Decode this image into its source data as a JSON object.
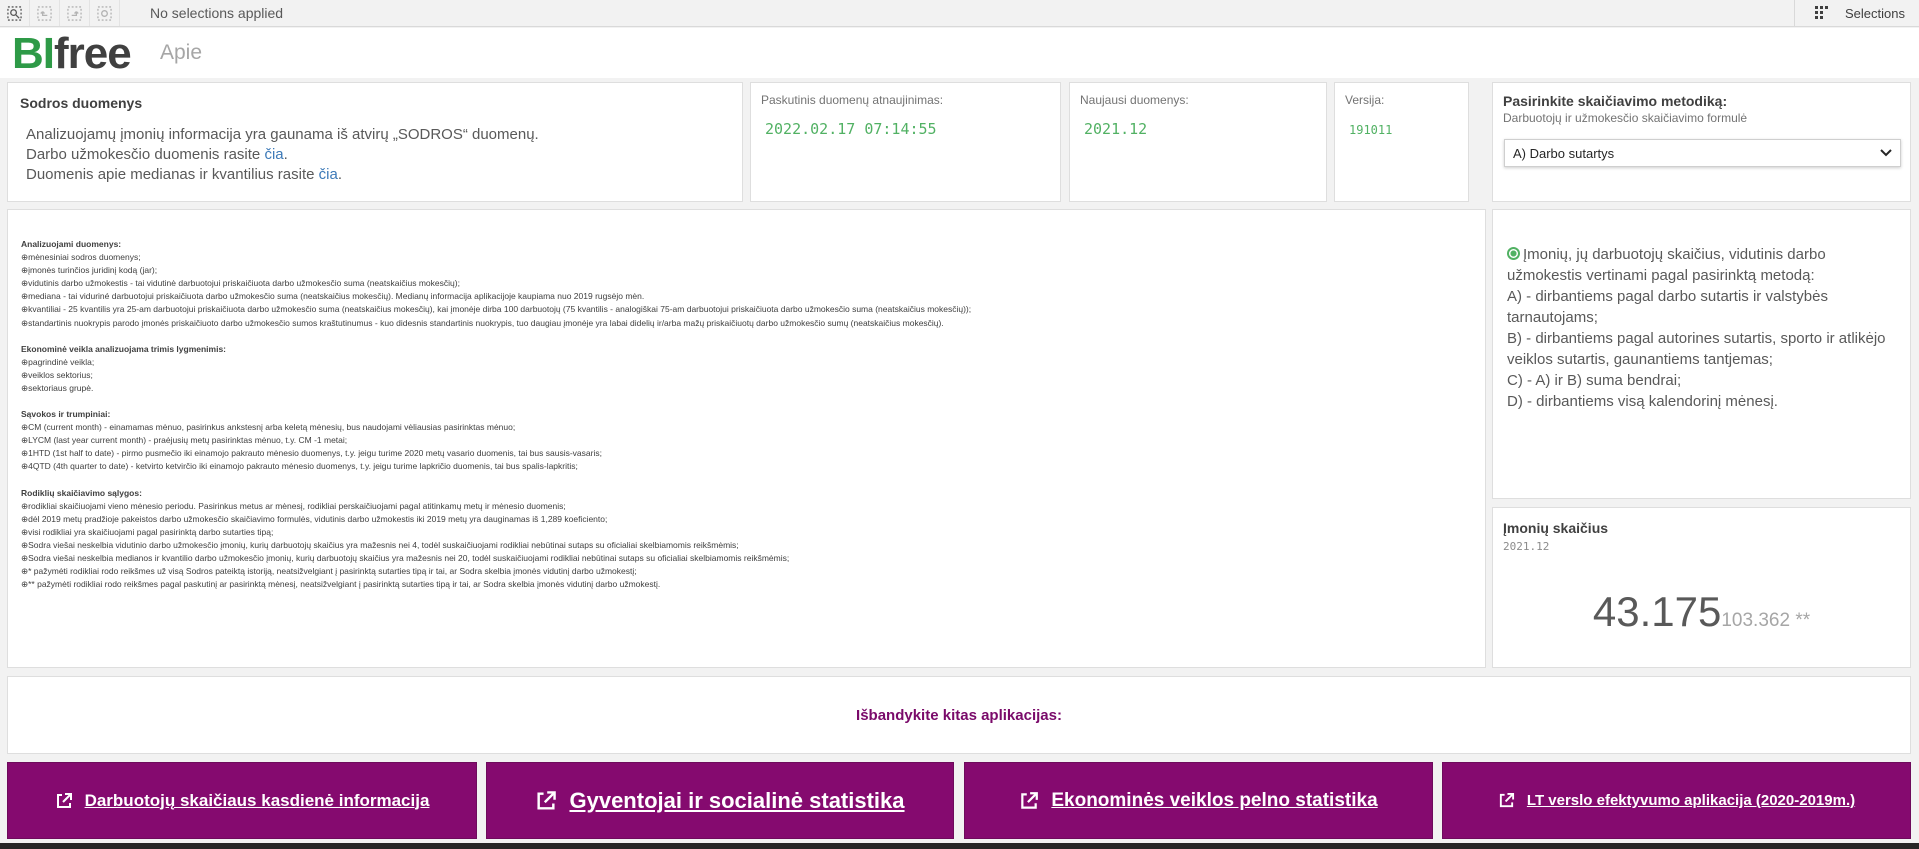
{
  "toolbar": {
    "no_selections": "No selections applied",
    "selections_label": "Selections"
  },
  "header": {
    "logo_bi": "BI",
    "logo_free": "free",
    "sheet_title": "Apie"
  },
  "sodros": {
    "title": "Sodros duomenys",
    "line1": "Analizuojamų įmonių informacija yra gaunama iš atvirų „SODROS“ duomenų.",
    "line2_prefix": "Darbo užmokesčio duomenis rasite ",
    "line2_link": "čia",
    "line2_suffix": ".",
    "line3_prefix": "Duomenis apie medianas ir kvantilius rasite ",
    "line3_link": "čia",
    "line3_suffix": "."
  },
  "kpis": {
    "last_update_label": "Paskutinis duomenų atnaujinimas:",
    "last_update_value": "2022.02.17 07:14:55",
    "latest_data_label": "Naujausi duomenys:",
    "latest_data_value": "2021.12",
    "version_label": "Versija:",
    "version_value": "191011"
  },
  "method": {
    "title": "Pasirinkite skaičiavimo metodiką:",
    "subtitle": "Darbuotojų ir užmokesčio skaičiavimo formulė",
    "selected": "A) Darbo sutartys"
  },
  "info": {
    "sec1_title": "Analizuojami duomenys:",
    "sec1_items": [
      "⊕mėnesiniai sodros duomenys;",
      "⊕įmonės turinčios juridinį kodą (jar);",
      "⊕vidutinis darbo užmokestis - tai vidutinė darbuotojui priskaičiuota darbo užmokesčio suma (neatskaičius mokesčių);",
      "⊕mediana - tai viduriné darbuotojui priskaičiuota darbo užmokesčio suma (neatskaičius mokesčių). Medianų informacija aplikacijoje kaupiama nuo 2019 rugsėjo mėn.",
      "⊕kvantiliai - 25 kvantilis yra 25-am darbuotojui priskaičiuota darbo užmokesčio suma (neatskaičius mokesčių), kai įmonėje dirba 100 darbuotojų (75 kvantilis - analogiškai 75-am darbuotojui priskaičiuota darbo užmokesčio suma (neatskaičius mokesčių));",
      "⊕standartinis nuokrypis parodo įmonės priskaičiuoto darbo užmokesčio sumos kraštutinumus - kuo didesnis standartinis nuokrypis, tuo daugiau įmonėje yra labai didelių ir/arba mažų priskaičiuotų darbo užmokesčio sumų (neatskaičius mokesčių)."
    ],
    "sec2_title": "Ekonominė veikla analizuojama trimis lygmenimis:",
    "sec2_items": [
      "⊕pagrindinė veikla;",
      "⊕veiklos sektorius;",
      "⊕sektoriaus grupė."
    ],
    "sec3_title": "Sąvokos ir trumpiniai:",
    "sec3_items": [
      "⊕CM (current month) - einamamas mėnuo, pasirinkus ankstesnį arba keletą mėnesių, bus naudojami vėliausias pasirinktas mėnuo;",
      "⊕LYCM (last year current month) - praėjusių metų pasirinktas mėnuo, t.y. CM -1 metai;",
      "⊕1HTD (1st half to date) - pirmo pusmečio iki einamojo pakrauto mėnesio duomenys, t.y. jeigu turime 2020 metų vasario duomenis, tai bus sausis-vasaris;",
      "⊕4QTD (4th quarter to date) - ketvirto ketvirčio iki einamojo pakrauto mėnesio duomenys, t.y. jeigu turime lapkričio duomenis, tai bus spalis-lapkritis;"
    ],
    "sec4_title": "Rodiklių skaičiavimo sąlygos:",
    "sec4_items": [
      "⊕rodikliai skaičiuojami vieno mėnesio periodu. Pasirinkus metus ar mėnesį, rodikliai perskaičiuojami pagal atitinkamų metų ir mėnesio duomenis;",
      "⊕dėl 2019 metų pradžioje pakeistos darbo užmokesčio skaičiavimo formulės, vidutinis darbo užmokestis iki 2019 metų yra dauginamas iš 1,289 koeficiento;",
      "⊕visi rodikliai yra skaičiuojami pagal pasirinktą darbo sutarties tipą;",
      "⊕Sodra viešai neskelbia vidutinio darbo užmokesčio įmonių, kurių darbuotojų skaičius yra mažesnis nei 4, todėl suskaičiuojami rodikliai nebūtinai sutaps su oficialiai skelbiamomis reikšmėmis;",
      "⊕Sodra viešai neskelbia medianos ir kvantilio darbo užmokesčio įmonių, kurių darbuotojų skaičius yra mažesnis nei 20, todėl suskaičiuojami rodikliai nebūtinai sutaps su oficialiai skelbiamomis reikšmėmis;",
      "⊕* pažymėti rodikliai rodo reikšmes už visą Sodros pateiktą istoriją, neatsižvelgiant į pasirinktą sutarties tipą ir tai, ar Sodra skelbia įmonės vidutinį darbo užmokestį;",
      "⊕** pažymėti rodikliai rodo reikšmes pagal paskutinį ar pasirinktą mėnesį, neatsižvelgiant į pasirinktą sutarties tipą ir tai, ar Sodra skelbia įmonės vidutinį darbo užmokestį."
    ]
  },
  "desc": {
    "intro": "Įmonių, jų darbuotojų skaičius, vidutinis darbo užmokestis vertinami pagal pasirinktą metodą:",
    "a": "A) - dirbantiems pagal darbo sutartis ir valstybės tarnautojams;",
    "b": "B) - dirbantiems pagal autorines sutartis, sporto ir atlikėjo veiklos sutartis, gaunantiems tantjemas;",
    "c": "C) - A) ir B) suma bendrai;",
    "d": "D) - dirbantiems visą kalendorinį mėnesį."
  },
  "companies": {
    "title": "Įmonių skaičius",
    "date": "2021.12",
    "value": "43.175",
    "secondary": "103.362 **"
  },
  "try_apps": "Išbandykite kitas aplikacijas:",
  "apps": [
    "Darbuotojų skaičiaus kasdienė informacija",
    "Gyventojai ir socialinė statistika",
    "Ekonominės veiklos pelno statistika",
    "LT verslo efektyvumo aplikacija (2020-2019m.)"
  ],
  "colors": {
    "brand_green": "#2e9a47",
    "value_green": "#51b163",
    "app_purple": "#850a6f",
    "link_blue": "#3d7ab8"
  }
}
